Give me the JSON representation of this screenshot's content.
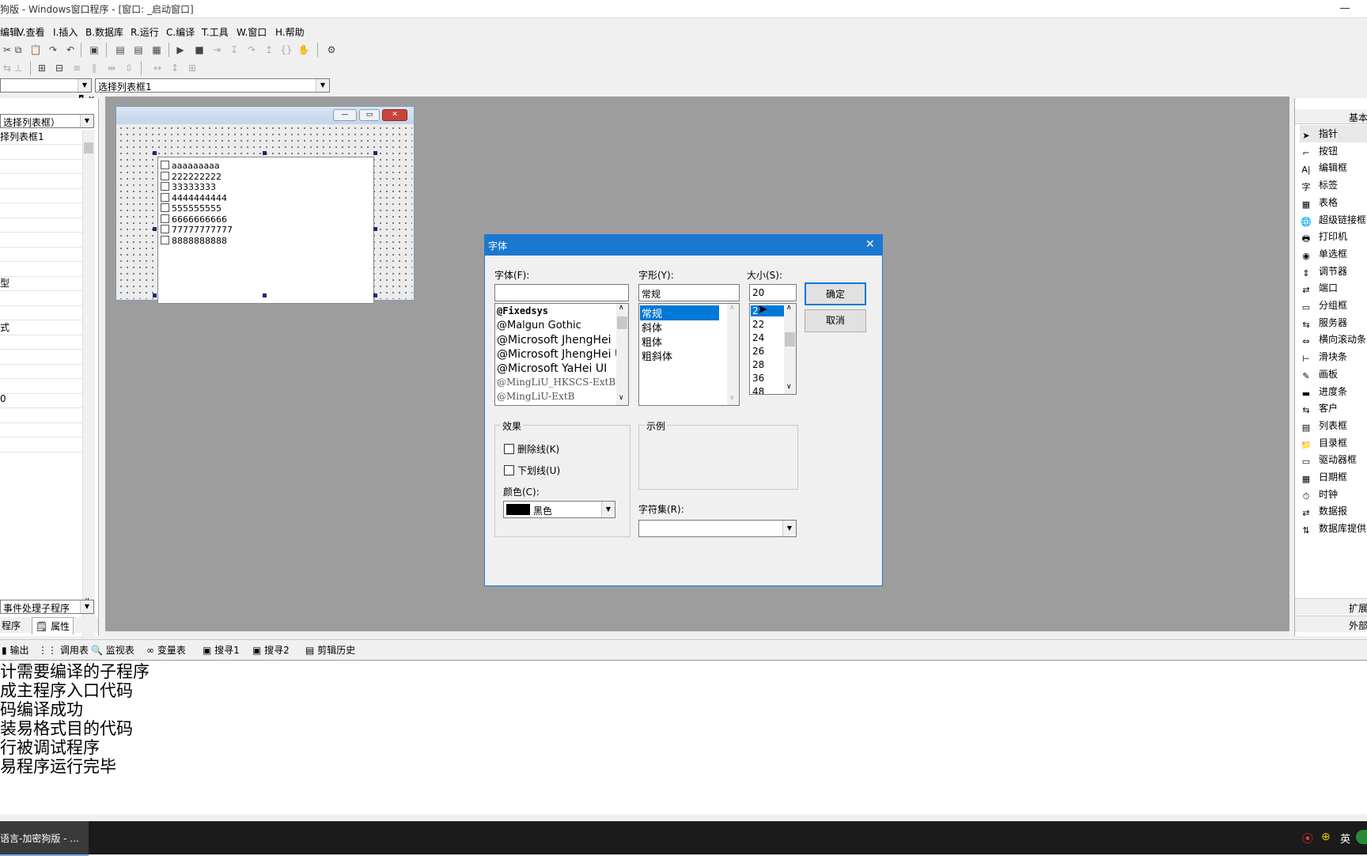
{
  "window": {
    "title": "狗版 - Windows窗口程序 - [窗口: _启动窗口]"
  },
  "menu": [
    "编辑",
    "V.查看",
    "I.插入",
    "B.数据库",
    "R.运行",
    "C.编译",
    "T.工具",
    "W.窗口",
    "H.帮助"
  ],
  "toolbar": {
    "component_combo": "选择列表框1"
  },
  "left_panel": {
    "type_combo": "选择列表框）",
    "rows": [
      "择列表框1",
      "",
      "",
      "",
      "",
      "",
      "",
      "",
      "",
      "",
      "型",
      "",
      "",
      "式",
      "",
      "",
      "",
      "",
      "0",
      "",
      "",
      ""
    ],
    "bottom_combo": "事件处理子程序",
    "tabs": [
      "程序",
      "属性"
    ]
  },
  "designer": {
    "items": [
      "aaaaaaaaa",
      "222222222",
      "33333333",
      "4444444444",
      "555555555",
      "6666666666",
      "77777777777",
      "8888888888"
    ]
  },
  "font_dialog": {
    "title": "字体",
    "font_label": "字体(F):",
    "font_value": "",
    "fonts": [
      "@Fixedsys",
      "@Malgun Gothic",
      "@Microsoft JhengHei",
      "@Microsoft JhengHei U",
      "@Microsoft YaHei UI",
      "@MingLiU_HKSCS-ExtB",
      "@MingLiU-ExtB"
    ],
    "style_label": "字形(Y):",
    "style_value": "常规",
    "styles": [
      "常规",
      "斜体",
      "粗体",
      "粗斜体"
    ],
    "size_label": "大小(S):",
    "size_value": "20",
    "sizes": [
      "2",
      "22",
      "24",
      "26",
      "28",
      "36",
      "48"
    ],
    "ok": "确定",
    "cancel": "取消",
    "effects_label": "效果",
    "strike_label": "删除线(K)",
    "underline_label": "下划线(U)",
    "color_label": "颜色(C):",
    "color_value": "黑色",
    "sample_label": "示例",
    "charset_label": "字符集(R):",
    "charset_value": ""
  },
  "right_panel": {
    "header": "基本",
    "tools": [
      "指针",
      "按钮",
      "编辑框",
      "标签",
      "表格",
      "超级链接框",
      "打印机",
      "单选框",
      "调节器",
      "端口",
      "分组框",
      "服务器",
      "横向滚动条",
      "滑块条",
      "画板",
      "进度条",
      "客户",
      "列表框",
      "目录框",
      "驱动器框",
      "日期框",
      "时钟",
      "数据报",
      "数据库提供"
    ],
    "tabs": [
      "扩展",
      "外部"
    ]
  },
  "bottom_tabs": [
    "输出",
    "调用表",
    "监视表",
    "变量表",
    "搜寻1",
    "搜寻2",
    "剪辑历史"
  ],
  "output_lines": [
    "计需要编译的子程序",
    "成主程序入口代码",
    "码编译成功",
    "装易格式目的代码",
    "行被调试程序",
    "易程序运行完毕"
  ],
  "taskbar": {
    "app": "语言-加密狗版 - ...",
    "ime": "英"
  }
}
